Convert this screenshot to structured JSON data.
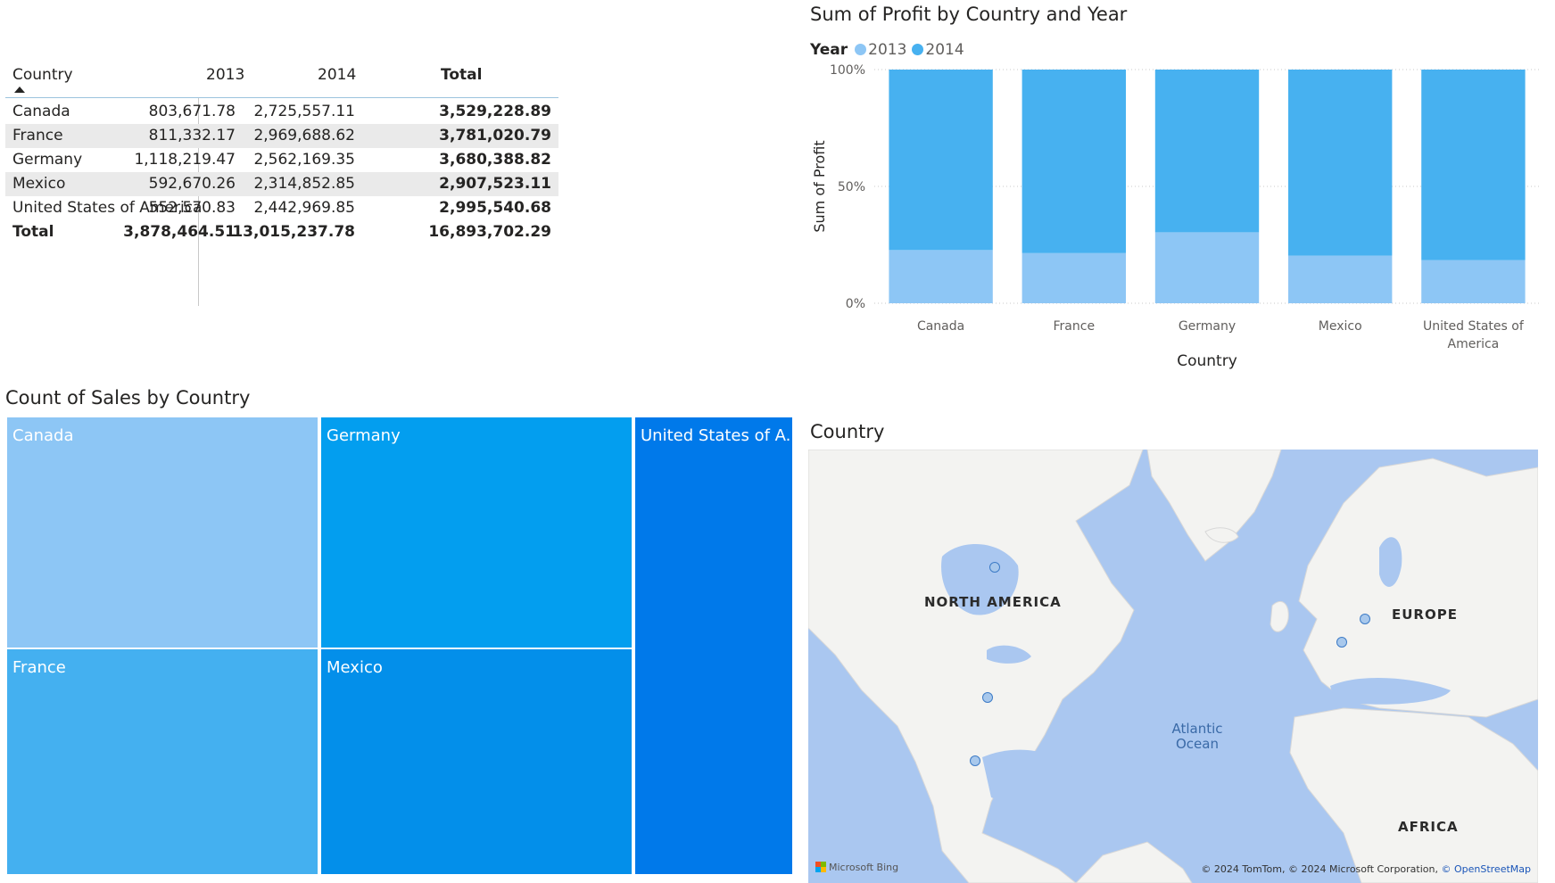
{
  "matrix": {
    "headers": {
      "country": "Country",
      "y2013": "2013",
      "y2014": "2014",
      "total": "Total"
    },
    "rows": [
      {
        "country": "Canada",
        "y2013": "803,671.78",
        "y2014": "2,725,557.11",
        "total": "3,529,228.89"
      },
      {
        "country": "France",
        "y2013": "811,332.17",
        "y2014": "2,969,688.62",
        "total": "3,781,020.79"
      },
      {
        "country": "Germany",
        "y2013": "1,118,219.47",
        "y2014": "2,562,169.35",
        "total": "3,680,388.82"
      },
      {
        "country": "Mexico",
        "y2013": "592,670.26",
        "y2014": "2,314,852.85",
        "total": "2,907,523.11"
      },
      {
        "country": "United States of America",
        "y2013": "552,570.83",
        "y2014": "2,442,969.85",
        "total": "2,995,540.68"
      }
    ],
    "total_row": {
      "label": "Total",
      "y2013": "3,878,464.51",
      "y2014": "13,015,237.78",
      "total": "16,893,702.29"
    }
  },
  "chart_data": [
    {
      "type": "bar",
      "stacked_percent": true,
      "title": "Sum of Profit by Country and Year",
      "xlabel": "Country",
      "ylabel": "Sum of Profit",
      "legend_title": "Year",
      "legend_position": "top-left",
      "categories": [
        "Canada",
        "France",
        "Germany",
        "Mexico",
        "United States of America"
      ],
      "category_labels": [
        [
          "Canada"
        ],
        [
          "France"
        ],
        [
          "Germany"
        ],
        [
          "Mexico"
        ],
        [
          "United States of",
          "America"
        ]
      ],
      "series": [
        {
          "name": "2013",
          "color": "#8dc6f5",
          "values": [
            803671.78,
            811332.17,
            1118219.47,
            592670.26,
            552570.83
          ]
        },
        {
          "name": "2014",
          "color": "#47b1f0",
          "values": [
            2725557.11,
            2969688.62,
            2562169.35,
            2314852.85,
            2442969.85
          ]
        }
      ],
      "y_ticks": [
        "0%",
        "50%",
        "100%"
      ],
      "ylim": [
        0,
        100
      ],
      "grid": true
    },
    {
      "type": "treemap",
      "title": "Count of Sales by Country",
      "tiles": [
        {
          "label": "Canada",
          "color": "#8dc6f5"
        },
        {
          "label": "Germany",
          "color": "#039eef"
        },
        {
          "label": "France",
          "color": "#44b0f0"
        },
        {
          "label": "Mexico",
          "color": "#038fea"
        },
        {
          "label": "United States of A...",
          "color": "#0079ea"
        }
      ]
    }
  ],
  "map": {
    "title": "Country",
    "labels": {
      "north_america": "NORTH AMERICA",
      "europe": "EUROPE",
      "africa": "AFRICA",
      "ocean_line1": "Atlantic",
      "ocean_line2": "Ocean"
    },
    "bing": "Microsoft Bing",
    "attribution": "© 2024 TomTom, © 2024 Microsoft Corporation,",
    "attribution_link": "© OpenStreetMap",
    "colors": {
      "water": "#aac7f0",
      "land": "#f3f3f1",
      "pin": "#3d7bc6"
    }
  }
}
